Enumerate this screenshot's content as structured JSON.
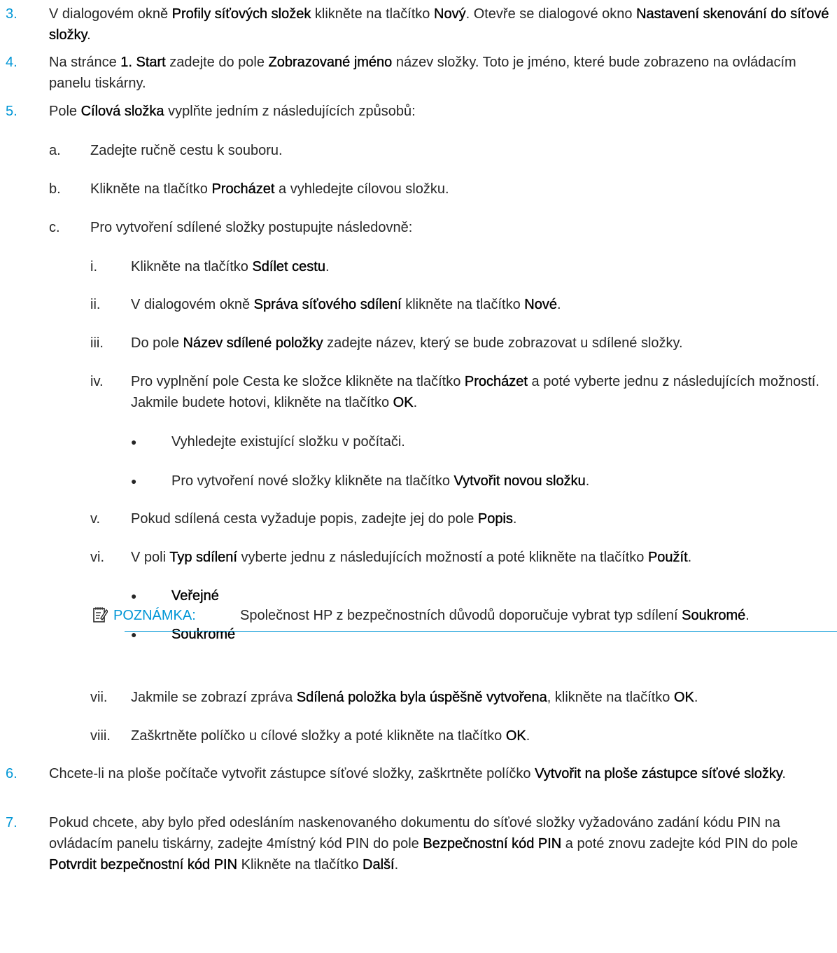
{
  "steps": [
    {
      "num": "3.",
      "parts": [
        "V dialogovém okně ",
        {
          "b": "Profily síťových složek"
        },
        " klikněte na tlačítko ",
        {
          "b": "Nový"
        },
        ". Otevře se dialogové okno ",
        {
          "b": "Nastavení skenování do síťové složky"
        },
        "."
      ]
    },
    {
      "num": "4.",
      "parts": [
        "Na stránce ",
        {
          "b": "1. Start"
        },
        " zadejte do pole ",
        {
          "b": "Zobrazované jméno"
        },
        " název složky. Toto je jméno, které bude zobrazeno na ovládacím panelu tiskárny."
      ]
    },
    {
      "num": "5.",
      "parts": [
        "Pole ",
        {
          "b": "Cílová složka"
        },
        " vyplňte jedním z následujících způsobů:"
      ]
    },
    {
      "num": "a.",
      "parts": [
        "Zadejte ručně cestu k souboru."
      ]
    },
    {
      "num": "b.",
      "parts": [
        "Klikněte na tlačítko ",
        {
          "b": "Procházet"
        },
        " a vyhledejte cílovou složku."
      ]
    },
    {
      "num": "c.",
      "parts": [
        "Pro vytvoření sdílené složky postupujte následovně:"
      ]
    },
    {
      "num": "i.",
      "parts": [
        "Klikněte na tlačítko ",
        {
          "b": "Sdílet cestu"
        },
        "."
      ]
    },
    {
      "num": "ii.",
      "parts": [
        "V dialogovém okně ",
        {
          "b": "Správa síťového sdílení"
        },
        " klikněte na tlačítko ",
        {
          "b": "Nové"
        },
        "."
      ]
    },
    {
      "num": "iii.",
      "parts": [
        "Do pole ",
        {
          "b": "Název sdílené položky"
        },
        " zadejte název, který se bude zobrazovat u sdílené složky."
      ]
    },
    {
      "num": "iv.",
      "parts": [
        "Pro vyplnění pole Cesta ke složce klikněte na tlačítko ",
        {
          "b": "Procházet"
        },
        " a poté vyberte jednu z následujících možností. Jakmile budete hotovi, klikněte na tlačítko ",
        {
          "b": "OK"
        },
        "."
      ]
    },
    {
      "num": "●",
      "parts": [
        "Vyhledejte existující složku v počítači."
      ]
    },
    {
      "num": "●",
      "parts": [
        "Pro vytvoření nové složky klikněte na tlačítko ",
        {
          "b": "Vytvořit novou složku"
        },
        "."
      ]
    },
    {
      "num": "v.",
      "parts": [
        "Pokud sdílená cesta vyžaduje popis, zadejte jej do pole ",
        {
          "b": "Popis"
        },
        "."
      ]
    },
    {
      "num": "vi.",
      "parts": [
        "V poli ",
        {
          "b": "Typ sdílení"
        },
        " vyberte jednu z následujících možností a poté klikněte na tlačítko ",
        {
          "b": "Použít"
        },
        "."
      ]
    },
    {
      "num": "●",
      "parts": [
        {
          "b": "Veřejné"
        }
      ]
    },
    {
      "num": "●",
      "parts": [
        {
          "b": "Soukromé"
        }
      ]
    },
    {
      "num": "vii.",
      "parts": [
        "Jakmile se zobrazí zpráva ",
        {
          "b": "Sdílená položka byla úspěšně vytvořena"
        },
        ", klikněte na tlačítko ",
        {
          "b": "OK"
        },
        "."
      ]
    },
    {
      "num": "viii.",
      "parts": [
        "Zaškrtněte políčko u cílové složky a poté klikněte na tlačítko ",
        {
          "b": "OK"
        },
        "."
      ]
    },
    {
      "num": "6.",
      "parts": [
        "Chcete-li na ploše počítače vytvořit zástupce síťové složky, zaškrtněte políčko ",
        {
          "b": "Vytvořit na ploše zástupce síťové složky"
        },
        "."
      ]
    },
    {
      "num": "7.",
      "parts": [
        "Pokud chcete, aby bylo před odesláním naskenovaného dokumentu do síťové složky vyžadováno zadání kódu PIN na ovládacím panelu tiskárny, zadejte 4místný kód PIN do pole ",
        {
          "b": "Bezpečnostní kód PIN"
        },
        " a poté znovu zadejte kód PIN do pole ",
        {
          "b": "Potvrdit bezpečnostní kód PIN"
        },
        " Klikněte na tlačítko ",
        {
          "b": "Další"
        },
        "."
      ]
    }
  ],
  "note": {
    "label": "POZNÁMKA:",
    "text_parts": [
      "Společnost HP z bezpečnostních důvodů doporučuje vybrat typ sdílení ",
      {
        "b": "Soukromé"
      },
      "."
    ]
  },
  "colors": {
    "accent": "#0096d6",
    "text": "#262626"
  }
}
